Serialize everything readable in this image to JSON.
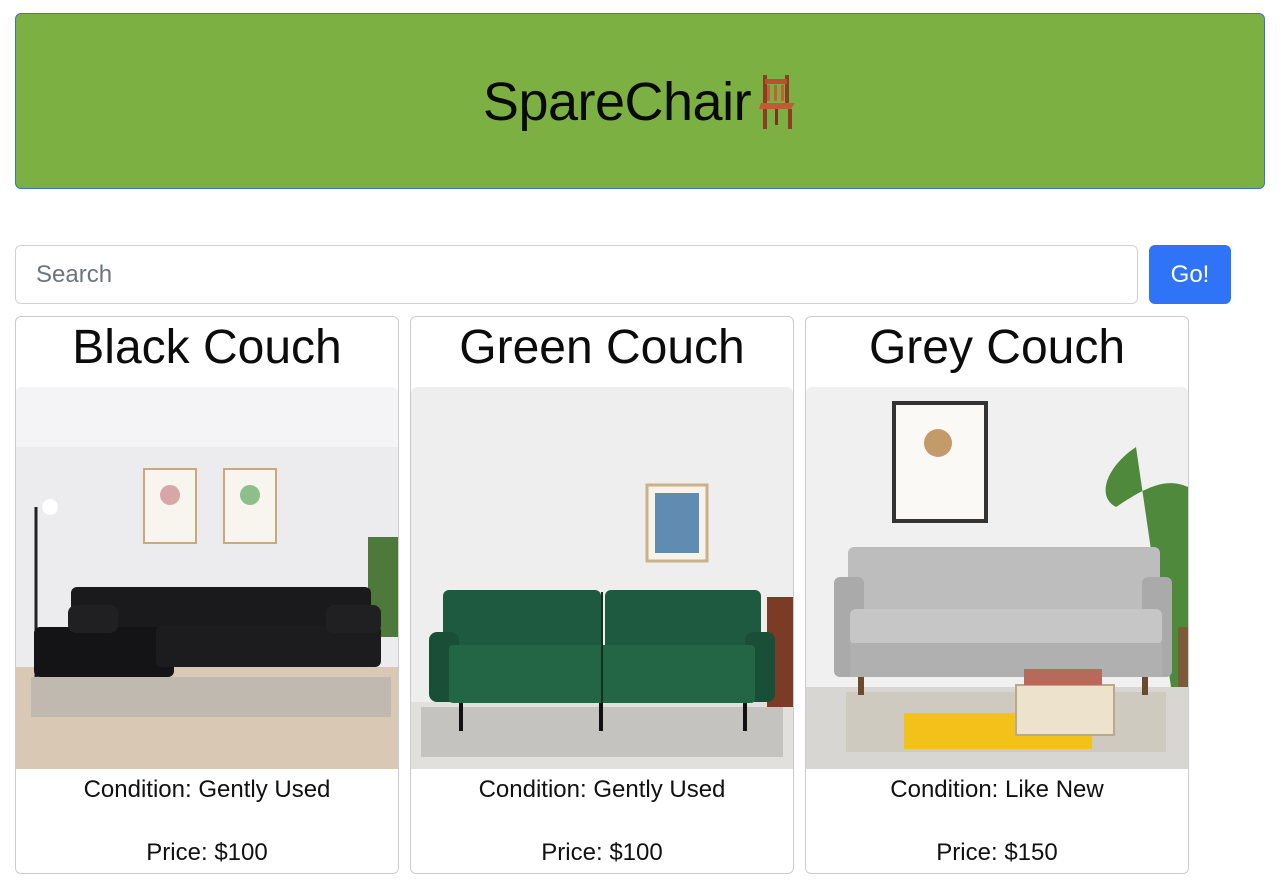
{
  "header": {
    "brand": "SpareChair",
    "brand_icon": "chair-icon",
    "background_color": "#7db042"
  },
  "search": {
    "placeholder": "Search",
    "value": "",
    "button_label": "Go!",
    "button_color": "#2f74f6"
  },
  "listings": [
    {
      "title": "Black Couch",
      "condition": "Condition: Gently Used",
      "price": "Price: $100",
      "image": "black-sectional-couch-photo"
    },
    {
      "title": "Green Couch",
      "condition": "Condition: Gently Used",
      "price": "Price: $100",
      "image": "green-futon-couch-photo"
    },
    {
      "title": "Grey Couch",
      "condition": "Condition: Like New",
      "price": "Price: $150",
      "image": "grey-three-seat-couch-photo"
    }
  ]
}
